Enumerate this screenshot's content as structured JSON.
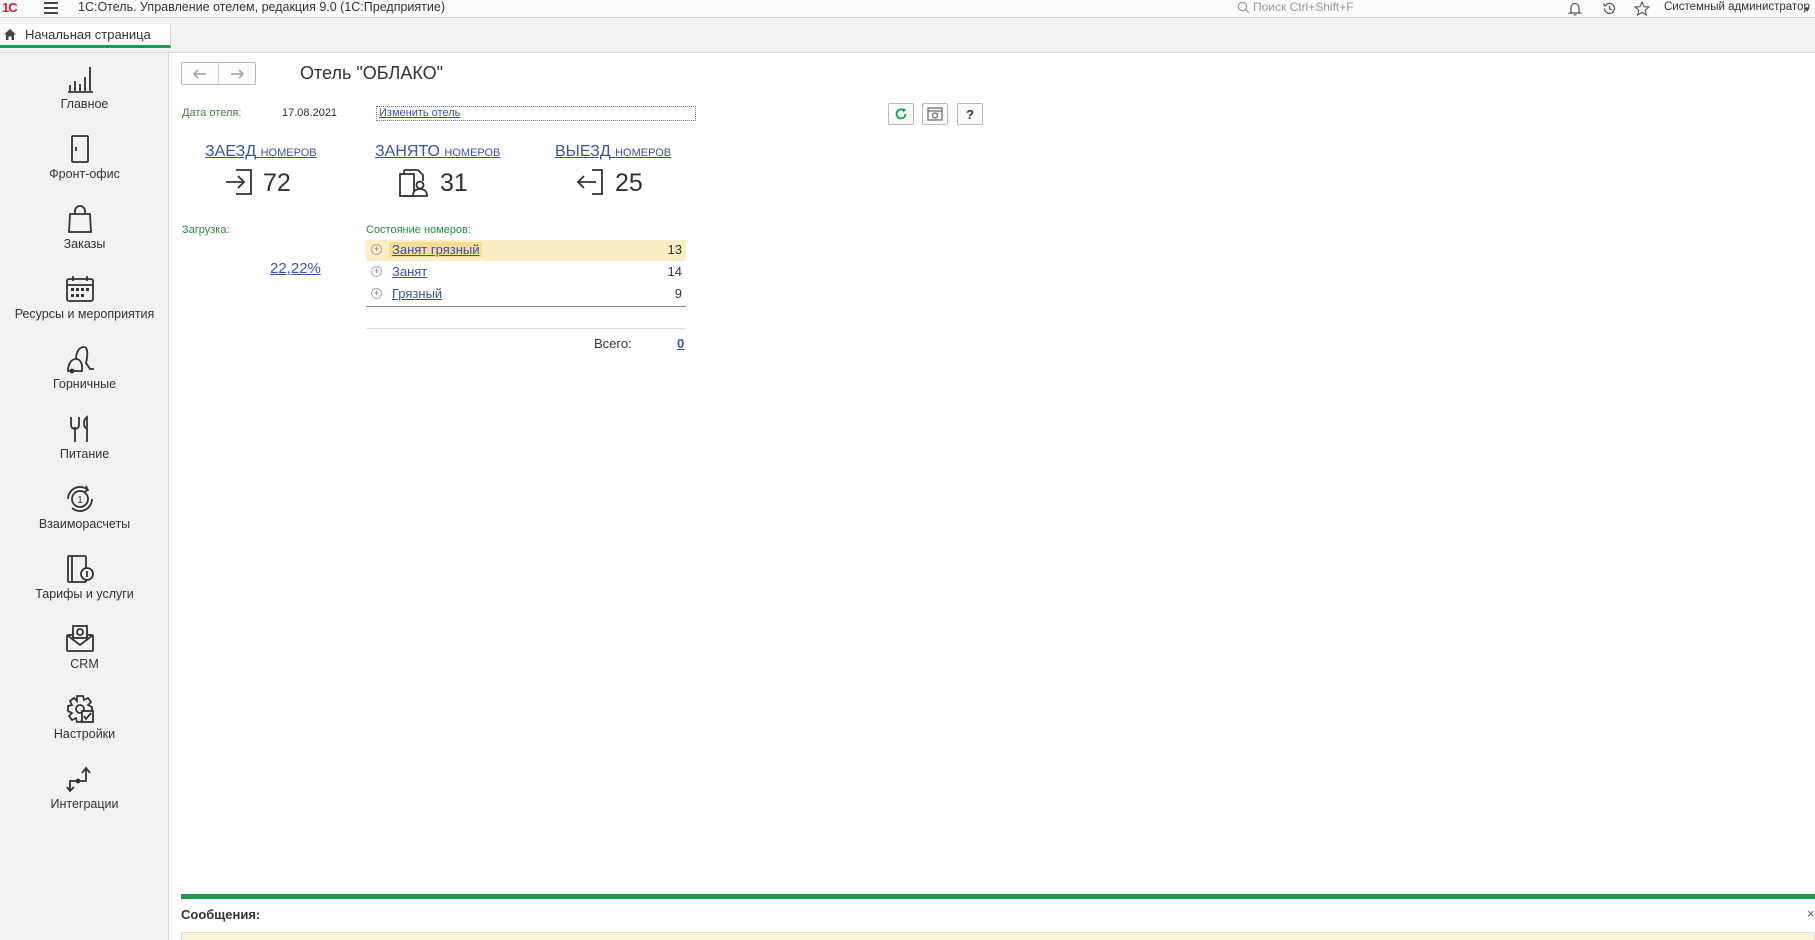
{
  "app": {
    "logo_text": "1С",
    "title": "1С:Отель. Управление отелем, редакция 9.0   (1С:Предприятие)",
    "search_placeholder": "Поиск Ctrl+Shift+F",
    "user": "Системный администратор"
  },
  "tabs": {
    "home_label": "Начальная страница"
  },
  "sidebar": {
    "items": [
      {
        "label": "Главное",
        "icon": "chart-bars-icon"
      },
      {
        "label": "Фронт-офис",
        "icon": "door-icon"
      },
      {
        "label": "Заказы",
        "icon": "shopping-bag-icon"
      },
      {
        "label": "Ресурсы и мероприятия",
        "icon": "calendar-icon"
      },
      {
        "label": "Горничные",
        "icon": "vacuum-icon"
      },
      {
        "label": "Питание",
        "icon": "cutlery-icon"
      },
      {
        "label": "Взаиморасчеты",
        "icon": "coin-cycle-icon"
      },
      {
        "label": "Тарифы и услуги",
        "icon": "tariff-book-icon"
      },
      {
        "label": "CRM",
        "icon": "crm-mail-icon"
      },
      {
        "label": "Настройки",
        "icon": "gear-icon"
      },
      {
        "label": "Интеграции",
        "icon": "integration-arrows-icon"
      }
    ]
  },
  "main": {
    "title": "Отель \"ОБЛАКО\"",
    "date_label": "Дата отеля:",
    "date_value": "17.08.2021",
    "change_hotel": "Изменить отель",
    "help_label": "?",
    "stats": [
      {
        "title": "ЗАЕЗД",
        "suffix": "НОМЕРОВ",
        "value": "72",
        "icon": "checkin-icon"
      },
      {
        "title": "ЗАНЯТО",
        "suffix": "НОМЕРОВ",
        "value": "31",
        "icon": "occupied-icon"
      },
      {
        "title": "ВЫЕЗД",
        "suffix": "НОМЕРОВ",
        "value": "25",
        "icon": "checkout-icon"
      }
    ],
    "load_label": "Загрузка:",
    "load_value": "22,22%",
    "state_label": "Состояние номеров:",
    "states": [
      {
        "name": "Занят грязный",
        "count": "13"
      },
      {
        "name": "Занят",
        "count": "14"
      },
      {
        "name": "Грязный",
        "count": "9"
      }
    ],
    "total_label": "Всего:",
    "total_value": "0"
  },
  "messages": {
    "title": "Сообщения:",
    "close": "×"
  },
  "colors": {
    "accent_green": "#1d9a4d",
    "link_blue": "#3a55a0",
    "selected_row": "#fbeec4",
    "logo_red": "#d0202e"
  }
}
